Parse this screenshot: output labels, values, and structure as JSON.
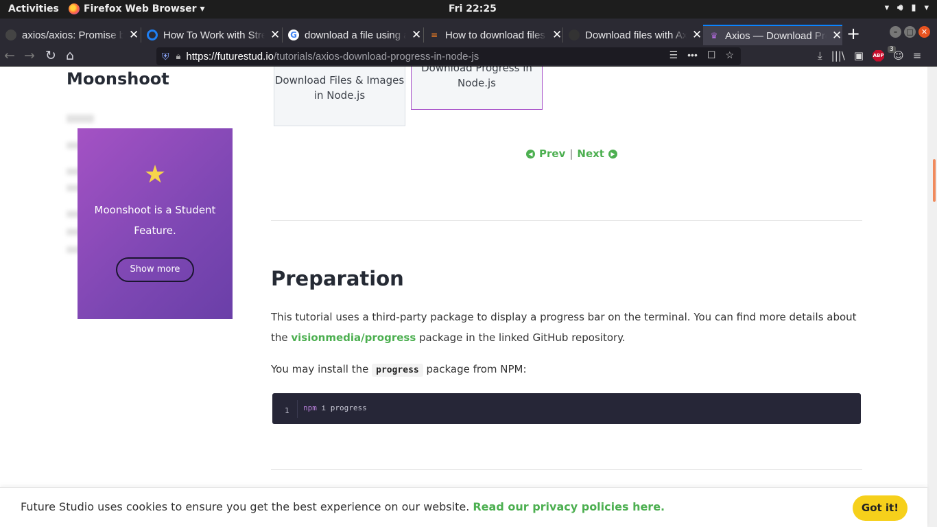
{
  "topbar": {
    "activities": "Activities",
    "app_name": "Firefox Web Browser ▾",
    "clock": "Fri 22:25"
  },
  "tabs": [
    {
      "title": "axios/axios: Promise based HTTP client",
      "icon": "github-icon"
    },
    {
      "title": "How To Work with Streams",
      "icon": "digitalocean-icon"
    },
    {
      "title": "download a file using axios",
      "icon": "google-icon"
    },
    {
      "title": "How to download files",
      "icon": "stackoverflow-icon"
    },
    {
      "title": "Download files with Axios",
      "icon": "github-icon"
    },
    {
      "title": "Axios — Download Progress",
      "icon": "futurestudio-icon",
      "active": true
    }
  ],
  "nav": {
    "url_domain": "https://futurestud.io",
    "url_path": "/tutorials/axios-download-progress-in-node-js",
    "abp_badge": "3"
  },
  "sidebar": {
    "heading": "Moonshoot",
    "promo_text": "Moonshoot is a Student Feature.",
    "promo_button": "Show more"
  },
  "related": {
    "prev_card": "Download Files & Images in Node.js",
    "current_card": "Download Progress in Node.js"
  },
  "pager": {
    "prev": "Prev",
    "next": "Next",
    "divider": "|"
  },
  "article": {
    "heading": "Preparation",
    "p1_before": "This tutorial uses a third-party package to display a progress bar on the terminal. You can find more details about the ",
    "p1_link": "visionmedia/progress",
    "p1_after": " package in the linked GitHub repository.",
    "p2_before": "You may install the ",
    "p2_code": "progress",
    "p2_after": " package from NPM:",
    "code_line_number": "1",
    "code_cmd": "npm",
    "code_rest": " i progress"
  },
  "cookie": {
    "message": "Future Studio uses cookies to ensure you get the best experience on our website. ",
    "link": "Read our privacy policies here.",
    "button": "Got it!"
  },
  "colors": {
    "accent_green": "#4caf50",
    "promo_purple": "#7d47b3",
    "cookie_yellow": "#f6d01b"
  }
}
